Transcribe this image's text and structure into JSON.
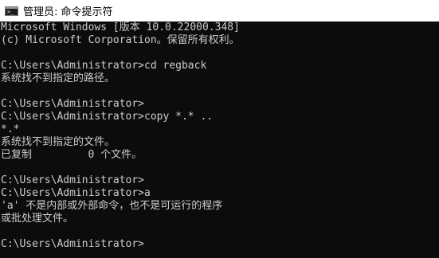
{
  "window": {
    "title": "管理员: 命令提示符",
    "icon": "cmd-prompt-icon",
    "icon_glyph": ">_"
  },
  "colors": {
    "background": "#0c0c0c",
    "text": "#cccccc",
    "titlebar": "#ffffff"
  },
  "console": {
    "lines": [
      "Microsoft Windows [版本 10.0.22000.348]",
      "(c) Microsoft Corporation。保留所有权利。",
      "",
      "C:\\Users\\Administrator>cd regback",
      "系统找不到指定的路径。",
      "",
      "C:\\Users\\Administrator>",
      "C:\\Users\\Administrator>copy *.* ..",
      "*.*",
      "系统找不到指定的文件。",
      "已复制         0 个文件。",
      "",
      "C:\\Users\\Administrator>",
      "C:\\Users\\Administrator>a",
      "'a' 不是内部或外部命令，也不是可运行的程序",
      "或批处理文件。",
      "",
      "C:\\Users\\Administrator>"
    ]
  }
}
